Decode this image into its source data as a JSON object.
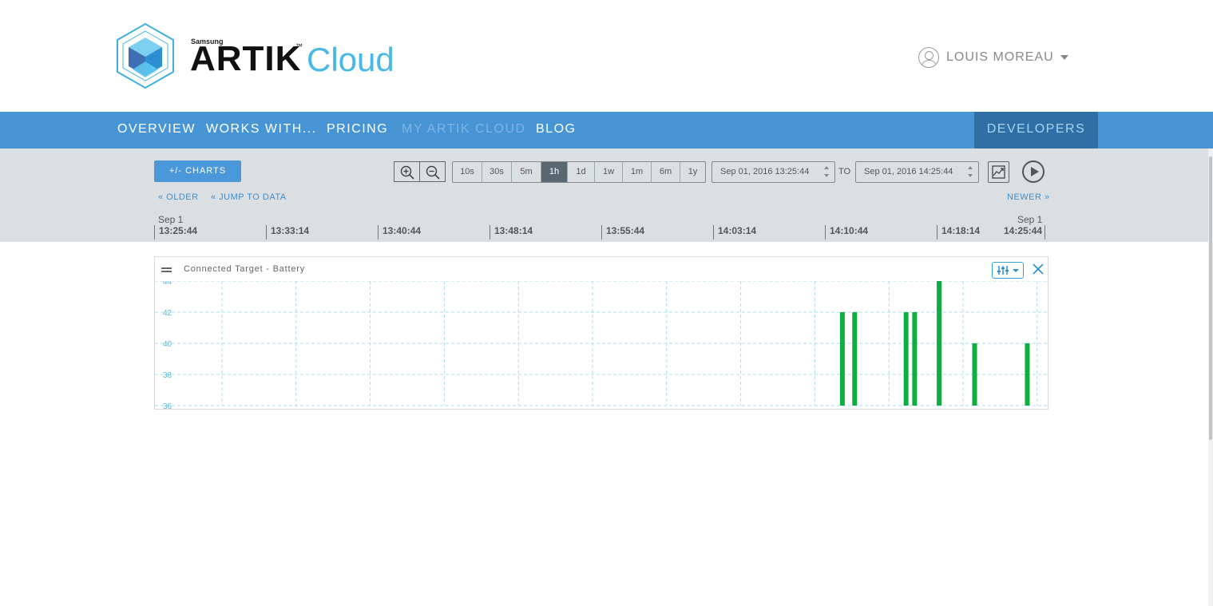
{
  "brand": {
    "maker": "Samsung",
    "product": "ARTIK",
    "trademark": "™",
    "suffix": "Cloud"
  },
  "user": {
    "name": "LOUIS MOREAU"
  },
  "nav": {
    "items": [
      {
        "label": "OVERVIEW",
        "active": false
      },
      {
        "label": "WORKS WITH...",
        "active": false
      },
      {
        "label": "PRICING",
        "active": false
      },
      {
        "label": "MY ARTIK CLOUD",
        "active": true
      },
      {
        "label": "BLOG",
        "active": false
      }
    ],
    "developers": "DEVELOPERS"
  },
  "toolbar": {
    "charts_button": "+/- CHARTS",
    "ranges": [
      "10s",
      "30s",
      "5m",
      "1h",
      "1d",
      "1w",
      "1m",
      "6m",
      "1y"
    ],
    "selected_range": "1h",
    "from_date": "Sep 01, 2016 13:25:44",
    "to_label": "TO",
    "to_date": "Sep 01, 2016 14:25:44",
    "older": "« OLDER",
    "jump": "« JUMP TO DATA",
    "newer": "NEWER »"
  },
  "timeline": {
    "start_date": "Sep 1",
    "end_date": "Sep 1",
    "ticks": [
      "13:25:44",
      "13:33:14",
      "13:40:44",
      "13:48:14",
      "13:55:44",
      "14:03:14",
      "14:10:44",
      "14:18:14",
      "14:25:44"
    ]
  },
  "panel": {
    "title": "Connected Target - Battery",
    "icons": [
      "drag-handle-icon",
      "sliders-icon",
      "close-icon"
    ]
  },
  "colors": {
    "accent": "#4895d6",
    "dev_bg": "#2f6fa6",
    "bar": "#0db040",
    "grid": "#a8dceb"
  },
  "chart_data": {
    "type": "bar",
    "title": "Connected Target - Battery",
    "ylim": [
      36,
      44
    ],
    "y_ticks": [
      36,
      38,
      40,
      42,
      44
    ],
    "xlim": [
      "13:25:44",
      "14:25:44"
    ],
    "x": [
      "14:12:15",
      "14:13:05",
      "14:16:35",
      "14:17:10",
      "14:18:50",
      "14:21:15",
      "14:24:50"
    ],
    "values": [
      42,
      42,
      42,
      42,
      44,
      40,
      40
    ],
    "grid": true
  }
}
